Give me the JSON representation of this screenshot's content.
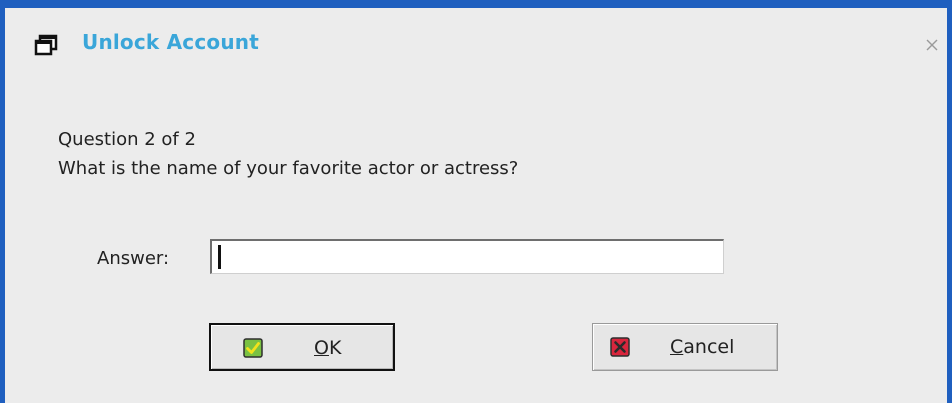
{
  "window": {
    "title": "Unlock Account",
    "title_color": "#3aa6d9",
    "border_color": "#1f5fbf",
    "icon": "window-icon",
    "close_icon": "close-icon"
  },
  "question": {
    "number_text": "Question 2 of 2",
    "prompt": "What is the name of your favorite actor or actress?"
  },
  "answer": {
    "label": "Answer:",
    "value": "",
    "placeholder": ""
  },
  "buttons": {
    "ok": {
      "mnemonic": "O",
      "rest": "K",
      "icon": "check-icon",
      "icon_color": "#7ac142"
    },
    "cancel": {
      "mnemonic": "C",
      "rest": "ancel",
      "icon": "x-icon",
      "icon_color": "#d9263d"
    }
  }
}
